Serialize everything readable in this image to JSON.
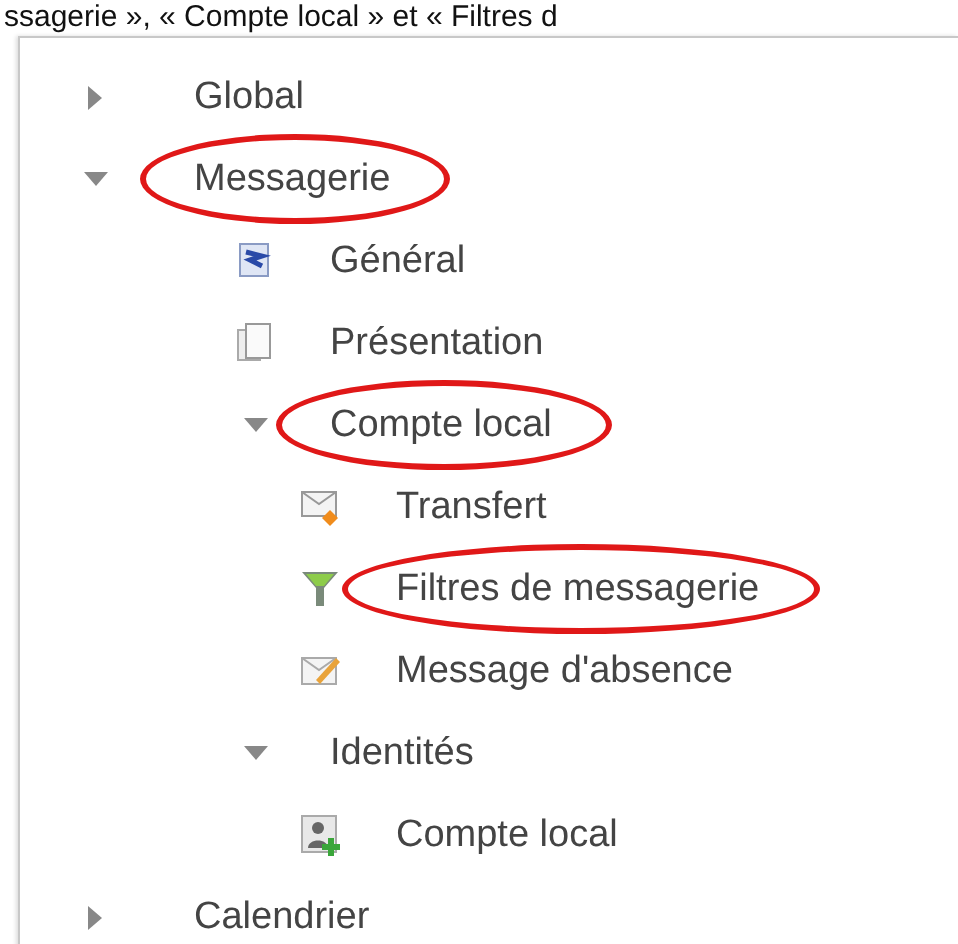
{
  "caption": "ssagerie », « Compte local » et « Filtres d",
  "tree": [
    {
      "label": "Global",
      "expanded": false,
      "highlighted": false
    },
    {
      "label": "Messagerie",
      "expanded": true,
      "highlighted": true,
      "children": [
        {
          "label": "Général",
          "kind": "general",
          "highlighted": false
        },
        {
          "label": "Présentation",
          "kind": "pages",
          "highlighted": false
        },
        {
          "label": "Compte local",
          "expanded": true,
          "highlighted": true,
          "children": [
            {
              "label": "Transfert",
              "kind": "forward",
              "highlighted": false
            },
            {
              "label": "Filtres de messagerie",
              "kind": "filter",
              "highlighted": true
            },
            {
              "label": "Message d'absence",
              "kind": "absence",
              "highlighted": false
            }
          ]
        },
        {
          "label": "Identités",
          "expanded": true,
          "highlighted": false,
          "children": [
            {
              "label": "Compte local",
              "kind": "identity",
              "highlighted": false
            }
          ]
        }
      ]
    },
    {
      "label": "Calendrier",
      "expanded": false,
      "highlighted": false
    }
  ]
}
